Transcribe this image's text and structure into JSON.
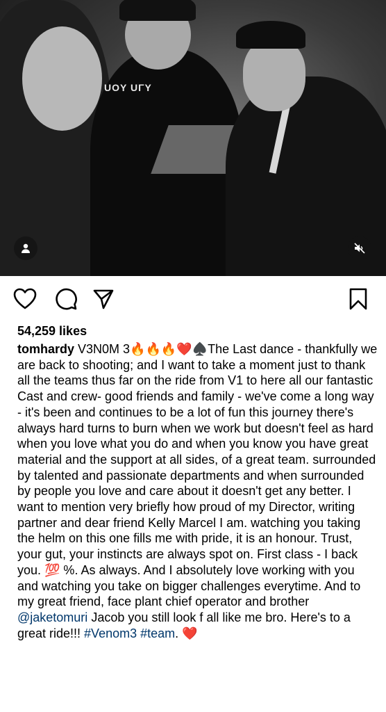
{
  "post": {
    "likes": "54,259 likes",
    "username": "tomhardy",
    "caption_start": " V3N0M 3🔥🔥🔥❤️♠️The Last dance - thankfully we are back to shooting; and I want  to take a moment just to thank all the teams thus far on the ride from V1 to here all our fantastic Cast and crew- good friends and family - we've come a long way - it's been and continues to be a lot of fun this journey there's always hard turns to burn when we work but doesn't feel as hard when you love what you do and when you know you have great material and the support at all sides, of a great team.  surrounded by talented and passionate departments and when surrounded by people you love and care about it doesn't get any better. I want to mention very briefly how proud  of my Director, writing partner and dear friend Kelly Marcel I am. watching you taking the helm on this one fills me with pride, it is an honour. Trust, your gut, your instincts are always spot on.  First class - I back you. 💯 %. As always. And I absolutely love working with you and watching you take on bigger challenges everytime. And to my great friend, face plant chief operator and brother  ",
    "mention": "@jaketomuri",
    "caption_mid": " Jacob you still look f all like me bro. Here's to a great ride!!! ",
    "tag1": "#Venom3",
    "space": " ",
    "tag2": "#team",
    "caption_end": ". ❤️"
  },
  "media": {
    "shirt_text": "UOY",
    "shirt_text2": "UΓY"
  },
  "icons": {
    "user": "user-tag-icon",
    "mute": "muted-speaker-icon",
    "like": "heart-icon",
    "comment": "comment-icon",
    "share": "paper-plane-icon",
    "save": "bookmark-icon"
  },
  "colors": {
    "link": "#00376b",
    "text": "#000000",
    "background": "#ffffff"
  }
}
